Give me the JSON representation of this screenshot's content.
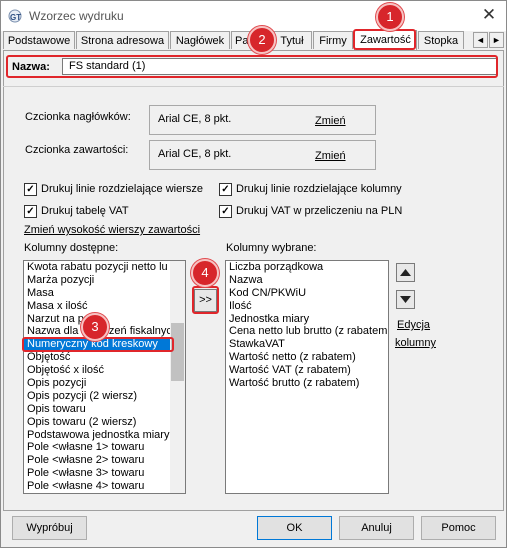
{
  "window": {
    "title": "Wzorzec wydruku"
  },
  "tabs": [
    {
      "label": "Podstawowe"
    },
    {
      "label": "Strona adresowa"
    },
    {
      "label": "Nagłówek"
    },
    {
      "label": "Pa"
    },
    {
      "label": "Tytuł"
    },
    {
      "label": "Firmy"
    },
    {
      "label": "Zawartość"
    },
    {
      "label": "Stopka"
    }
  ],
  "tab_scroll": {
    "left": "◄",
    "right": "►"
  },
  "nazwa": {
    "label": "Nazwa:",
    "value": "FS standard (1)"
  },
  "fonts": {
    "header_label": "Czcionka nagłówków:",
    "header_value": "Arial CE, 8 pkt.",
    "content_label": "Czcionka zawartości:",
    "content_value": "Arial CE, 8 pkt.",
    "change_link": "Zmień"
  },
  "checkboxes": [
    {
      "label": "Drukuj linie rozdzielające wiersze",
      "checked": true
    },
    {
      "label": "Drukuj linie rozdzielające kolumny",
      "checked": true
    },
    {
      "label": "Drukuj tabelę VAT",
      "checked": true
    },
    {
      "label": "Drukuj VAT w przeliczeniu na PLN",
      "checked": true
    }
  ],
  "row_height_link": "Zmień wysokość wierszy zawartości",
  "available": {
    "label": "Kolumny dostępne:",
    "items": [
      "Kwota rabatu pozycji netto lu",
      "Marża pozycji",
      "Masa",
      "Masa x ilość",
      "Narzut na po",
      "Nazwa dla urządzeń fiskalnych",
      "Numeryczny kod kreskowy",
      "Objętość",
      "Objętość x ilość",
      "Opis pozycji",
      "Opis pozycji (2 wiersz)",
      "Opis towaru",
      "Opis towaru (2 wiersz)",
      "Podstawowa jednostka miary",
      "Pole <własne 1> towaru",
      "Pole <własne 2> towaru",
      "Pole <własne 3> towaru",
      "Pole <własne 4> towaru"
    ],
    "selected": "Numeryczny kod kreskowy"
  },
  "move_button": ">>",
  "chosen": {
    "label": "Kolumny wybrane:",
    "items": [
      "Liczba porządkowa",
      "Nazwa",
      "Kod CN/PKWiU",
      "Ilość",
      "Jednostka miary",
      "Cena netto lub brutto (z rabatem",
      "StawkaVAT",
      "Wartość netto (z rabatem)",
      "Wartość VAT (z rabatem)",
      "Wartość brutto (z rabatem)"
    ]
  },
  "edit_link": {
    "line1": "Edycja",
    "line2": "kolumny"
  },
  "badges": [
    "1",
    "2",
    "3",
    "4"
  ],
  "buttons": {
    "preview": "Wypróbuj",
    "ok": "OK",
    "cancel": "Anuluj",
    "help": "Pomoc"
  },
  "colors": {
    "accent": "#0078d7",
    "highlight": "#e0262b"
  }
}
